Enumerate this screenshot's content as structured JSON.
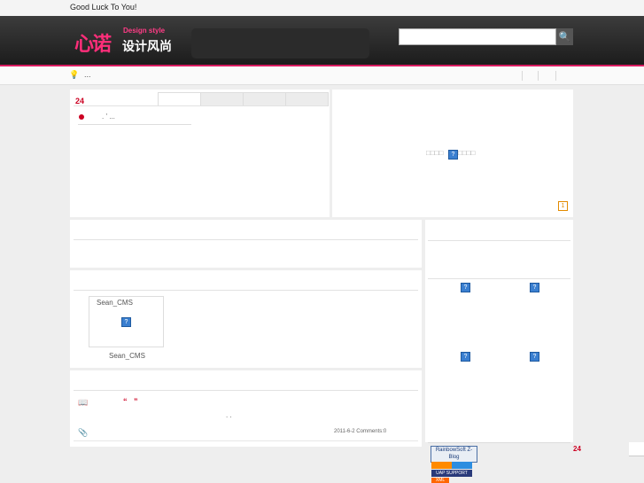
{
  "topbar": {
    "greeting": "Good Luck To You!"
  },
  "header": {
    "logo_main": "心诺",
    "logo_tagline": "Design style",
    "logo_cn": "设计风尚",
    "search_placeholder": "",
    "search_icon": "magnifier-icon",
    "accent_color": "#d81b60"
  },
  "notice": {
    "text": "..."
  },
  "post_panel": {
    "count": "24",
    "tabs": [
      "",
      "",
      "",
      ""
    ],
    "item_text": ". ' ..."
  },
  "slideshow": {
    "placeholder_text": "□□□□",
    "placeholder_text_after": "□□□□",
    "page_number": "1"
  },
  "gallery": {
    "author_top": "Sean_CMS",
    "author_bottom": "Sean_CMS"
  },
  "article": {
    "quote_open": "“",
    "quote_close": "”",
    "body_text": ". .",
    "meta": "2011-6-2 Comments:0"
  },
  "sidebar": {
    "count": "24",
    "badge_1": "RainbowSoft Z-Blog",
    "badge_2": "UAP SUPPORT",
    "badge_3": "XML"
  }
}
